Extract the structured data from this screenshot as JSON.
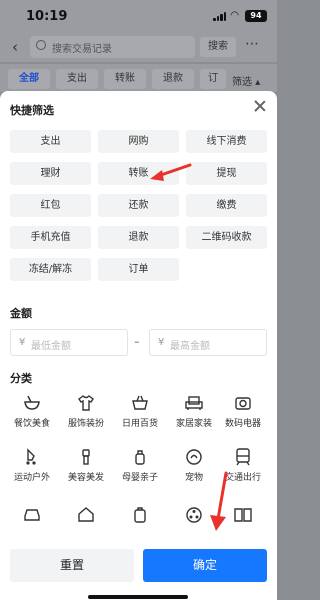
{
  "status": {
    "time": "10:19",
    "battery": "94"
  },
  "header": {
    "search_placeholder": "搜索交易记录",
    "search_button": "搜索"
  },
  "tabs": {
    "items": [
      "全部",
      "支出",
      "转账",
      "退款",
      "订"
    ],
    "filter_label": "筛选"
  },
  "sheet": {
    "quick_title": "快捷筛选",
    "quick_items": [
      "支出",
      "网购",
      "线下消费",
      "理财",
      "转账",
      "提现",
      "红包",
      "还款",
      "缴费",
      "手机充值",
      "退款",
      "二维码收款",
      "冻结/解冻",
      "订单"
    ],
    "amount_title": "金额",
    "amount_min_placeholder": "最低金额",
    "amount_max_placeholder": "最高金额",
    "currency_symbol": "¥",
    "amount_separator": "–",
    "category_title": "分类",
    "categories": [
      "餐饮美食",
      "服饰装扮",
      "日用百货",
      "家居家装",
      "数码电器",
      "运动户外",
      "美容美发",
      "母婴亲子",
      "宠物",
      "交通出行",
      "",
      "",
      "",
      "",
      ""
    ],
    "category_icons": [
      "bowl-icon",
      "shirt-icon",
      "basket-icon",
      "sofa-icon",
      "camera-icon",
      "skate-icon",
      "hairdryer-icon",
      "baby-bottle-icon",
      "pet-icon",
      "train-icon",
      "car-icon",
      "house-icon",
      "luggage-icon",
      "reel-icon",
      "book-icon"
    ]
  },
  "footer": {
    "reset_label": "重置",
    "confirm_label": "确定"
  },
  "colors": {
    "primary": "#1677ff",
    "annotation_arrow": "#e8322b",
    "chip_bg": "#f2f3f5"
  }
}
